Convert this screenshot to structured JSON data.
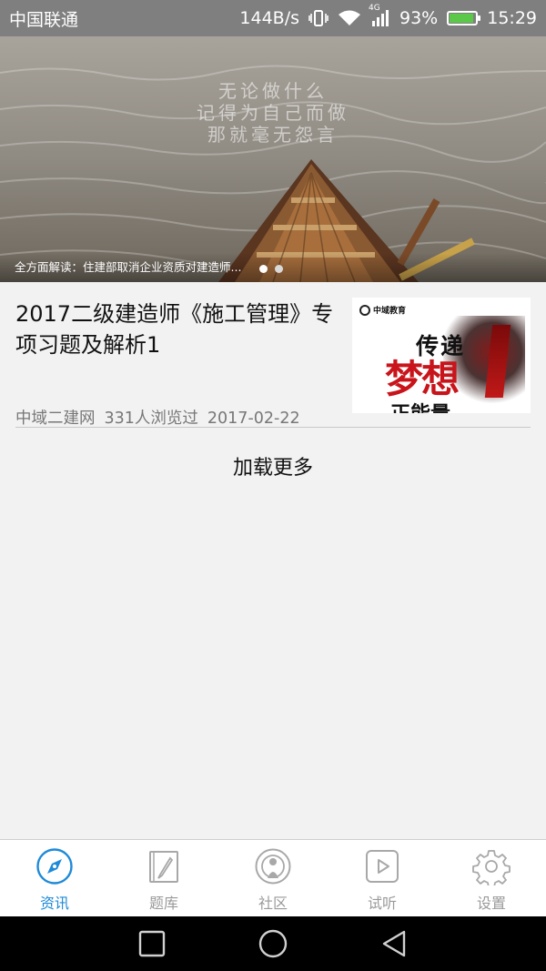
{
  "status_bar": {
    "carrier": "中国联通",
    "speed": "144B/s",
    "network": "4G",
    "battery": "93%",
    "battery_level": 0.93,
    "time": "15:29"
  },
  "banner": {
    "quote_lines": [
      "无论做什么",
      "记得为自己而做",
      "那就毫无怨言"
    ],
    "caption": "全方面解读：住建部取消企业资质对建造师...",
    "slide_count": 2,
    "active_slide": 1
  },
  "article": {
    "title": "2017二级建造师《施工管理》专项习题及解析1",
    "source": "中域二建网",
    "views": "331人浏览过",
    "date": "2017-02-22",
    "thumb": {
      "brand": "中域教育",
      "line1": "传递",
      "line2": "梦想",
      "line3": "正能量"
    }
  },
  "load_more": "加载更多",
  "tabs": [
    {
      "label": "资讯",
      "icon": "compass-icon",
      "active": true
    },
    {
      "label": "题库",
      "icon": "notebook-pen-icon",
      "active": false
    },
    {
      "label": "社区",
      "icon": "community-icon",
      "active": false
    },
    {
      "label": "试听",
      "icon": "play-video-icon",
      "active": false
    },
    {
      "label": "设置",
      "icon": "gear-icon",
      "active": false
    }
  ],
  "colors": {
    "accent": "#1f8ad8",
    "inactive": "#9a9a9a",
    "status_bar": "#7f7f7f",
    "battery_fill": "#5cc84a"
  }
}
